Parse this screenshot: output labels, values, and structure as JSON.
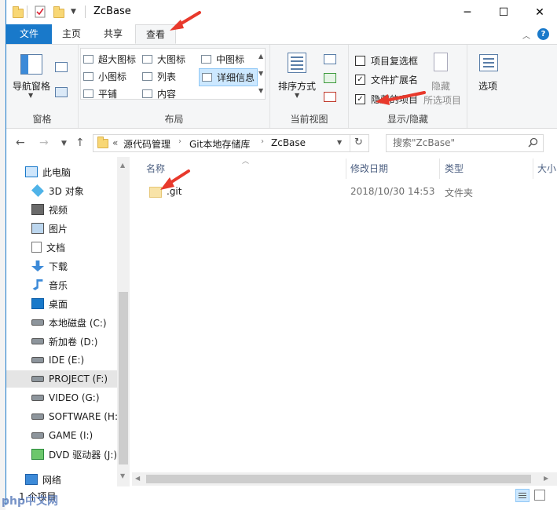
{
  "window": {
    "title": "ZcBase",
    "minimize": "─",
    "maximize": "☐",
    "close": "✕"
  },
  "tabs": {
    "file": "文件",
    "home": "主页",
    "share": "共享",
    "view": "查看"
  },
  "ribbon": {
    "panes": {
      "label": "窗格",
      "nav_pane": "导航窗格"
    },
    "layout": {
      "label": "布局",
      "items": [
        "超大图标",
        "大图标",
        "中图标",
        "小图标",
        "列表",
        "详细信息",
        "平铺",
        "内容"
      ]
    },
    "current_view": {
      "label": "当前视图",
      "sort_by": "排序方式"
    },
    "show_hide": {
      "label": "显示/隐藏",
      "item_checkboxes": "项目复选框",
      "file_extensions": "文件扩展名",
      "hidden_items": "隐藏的项目",
      "hide_selected": "隐藏",
      "hide_selected_line2": "所选项目",
      "options": "选项"
    }
  },
  "address": {
    "prefix": "«",
    "crumbs": [
      "源代码管理",
      "Git本地存储库",
      "ZcBase"
    ],
    "search_placeholder": "搜索\"ZcBase\""
  },
  "nav": {
    "items": [
      {
        "label": "此电脑",
        "icon": "computer-icon"
      },
      {
        "label": "3D 对象",
        "icon": "3d-objects-icon"
      },
      {
        "label": "视频",
        "icon": "video-icon"
      },
      {
        "label": "图片",
        "icon": "picture-icon"
      },
      {
        "label": "文档",
        "icon": "document-icon"
      },
      {
        "label": "下载",
        "icon": "download-icon"
      },
      {
        "label": "音乐",
        "icon": "music-icon"
      },
      {
        "label": "桌面",
        "icon": "desktop-icon"
      },
      {
        "label": "本地磁盘 (C:)",
        "icon": "drive-icon"
      },
      {
        "label": "新加卷 (D:)",
        "icon": "drive-icon"
      },
      {
        "label": "IDE (E:)",
        "icon": "drive-icon"
      },
      {
        "label": "PROJECT (F:)",
        "icon": "drive-icon"
      },
      {
        "label": "VIDEO (G:)",
        "icon": "drive-icon"
      },
      {
        "label": "SOFTWARE (H:",
        "icon": "drive-icon"
      },
      {
        "label": "GAME (I:)",
        "icon": "drive-icon"
      },
      {
        "label": "DVD 驱动器 (J:)",
        "icon": "dvd-icon"
      },
      {
        "label": "网络",
        "icon": "network-icon"
      }
    ]
  },
  "columns": {
    "name": "名称",
    "date": "修改日期",
    "type": "类型",
    "size": "大小"
  },
  "files": [
    {
      "name": ".git",
      "date": "2018/10/30 14:53",
      "type": "文件夹"
    }
  ],
  "status": {
    "count": "1 个项目"
  },
  "watermark": "php中文网",
  "colors": {
    "accent": "#1979ca",
    "annotation_arrow": "#e8392c",
    "folder": "#f8d775"
  }
}
